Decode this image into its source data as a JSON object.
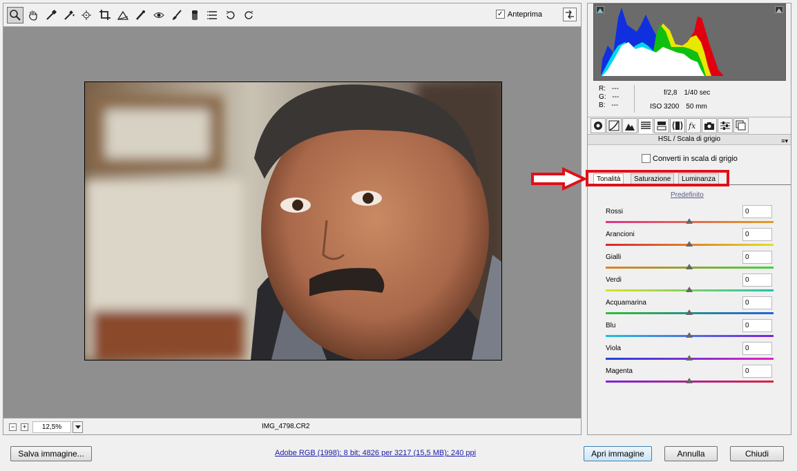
{
  "toolbar": {
    "tools": [
      "zoom-tool",
      "hand-tool",
      "white-balance-tool",
      "color-sampler-tool",
      "target-adjustment-tool",
      "crop-tool",
      "straighten-tool",
      "spot-removal-tool",
      "red-eye-tool",
      "adjustment-brush-tool",
      "graduated-filter-tool",
      "preferences-tool",
      "rotate-left-tool",
      "rotate-right-tool"
    ],
    "preview_label": "Anteprima",
    "preview_checked": true
  },
  "status": {
    "zoom": "12,5%",
    "filename": "IMG_4798.CR2"
  },
  "info": {
    "r_label": "R:",
    "r_value": "---",
    "g_label": "G:",
    "g_value": "---",
    "b_label": "B:",
    "b_value": "---",
    "aperture": "f/2,8",
    "shutter": "1/40 sec",
    "iso": "ISO 3200",
    "focal": "50 mm"
  },
  "panel": {
    "title": "HSL / Scala di grigio",
    "convert_label": "Converti in scala di grigio",
    "tabs": [
      "Tonalità",
      "Saturazione",
      "Luminanza"
    ],
    "default_link": "Predefinito",
    "sliders": [
      {
        "label": "Rossi",
        "value": "0",
        "c1": "#e0308a",
        "c2": "#e0a020"
      },
      {
        "label": "Arancioni",
        "value": "0",
        "c1": "#e02030",
        "c2": "#e0e020"
      },
      {
        "label": "Gialli",
        "value": "0",
        "c1": "#e08020",
        "c2": "#40d040"
      },
      {
        "label": "Verdi",
        "value": "0",
        "c1": "#e0e020",
        "c2": "#20c0b0"
      },
      {
        "label": "Acquamarina",
        "value": "0",
        "c1": "#30c030",
        "c2": "#2060e0"
      },
      {
        "label": "Blu",
        "value": "0",
        "c1": "#20c0e0",
        "c2": "#8020e0"
      },
      {
        "label": "Viola",
        "value": "0",
        "c1": "#2040e0",
        "c2": "#e020c0"
      },
      {
        "label": "Magenta",
        "value": "0",
        "c1": "#8020e0",
        "c2": "#e02040"
      }
    ]
  },
  "bottom": {
    "save_label": "Salva immagine...",
    "info_link": "Adobe RGB (1998); 8 bit; 4826 per 3217 (15,5 MB); 240 ppi",
    "open_label": "Apri immagine",
    "cancel_label": "Annulla",
    "close_label": "Chiudi"
  }
}
